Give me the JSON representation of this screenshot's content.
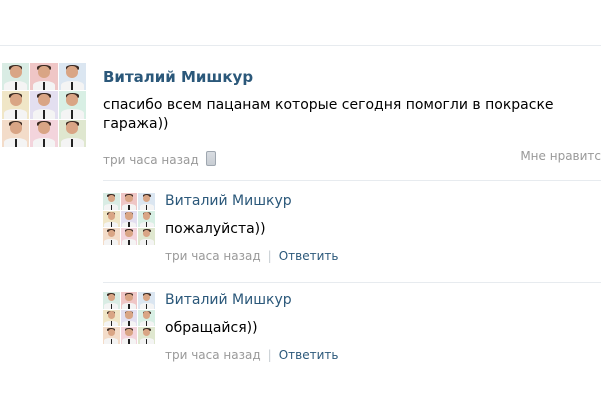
{
  "post": {
    "author": "Виталий Мишкур",
    "text_line1": "спасибо всем пацанам которые сегодня помогли в покраске",
    "text_line2": "гаража))",
    "time": "три часа назад",
    "like_label": "Мне нравитс"
  },
  "replies": [
    {
      "author": "Виталий Мишкур",
      "text": "пожалуйста))",
      "time": "три часа назад",
      "reply_label": "Ответить"
    },
    {
      "author": "Виталий Мишкур",
      "text": "обращайся))",
      "time": "три часа назад",
      "reply_label": "Ответить"
    }
  ],
  "icons": {
    "mobile": "mobile-phone-icon"
  },
  "colors": {
    "link_blue": "#2b587a",
    "meta_gray": "#999999",
    "divider": "#e7ebef"
  }
}
